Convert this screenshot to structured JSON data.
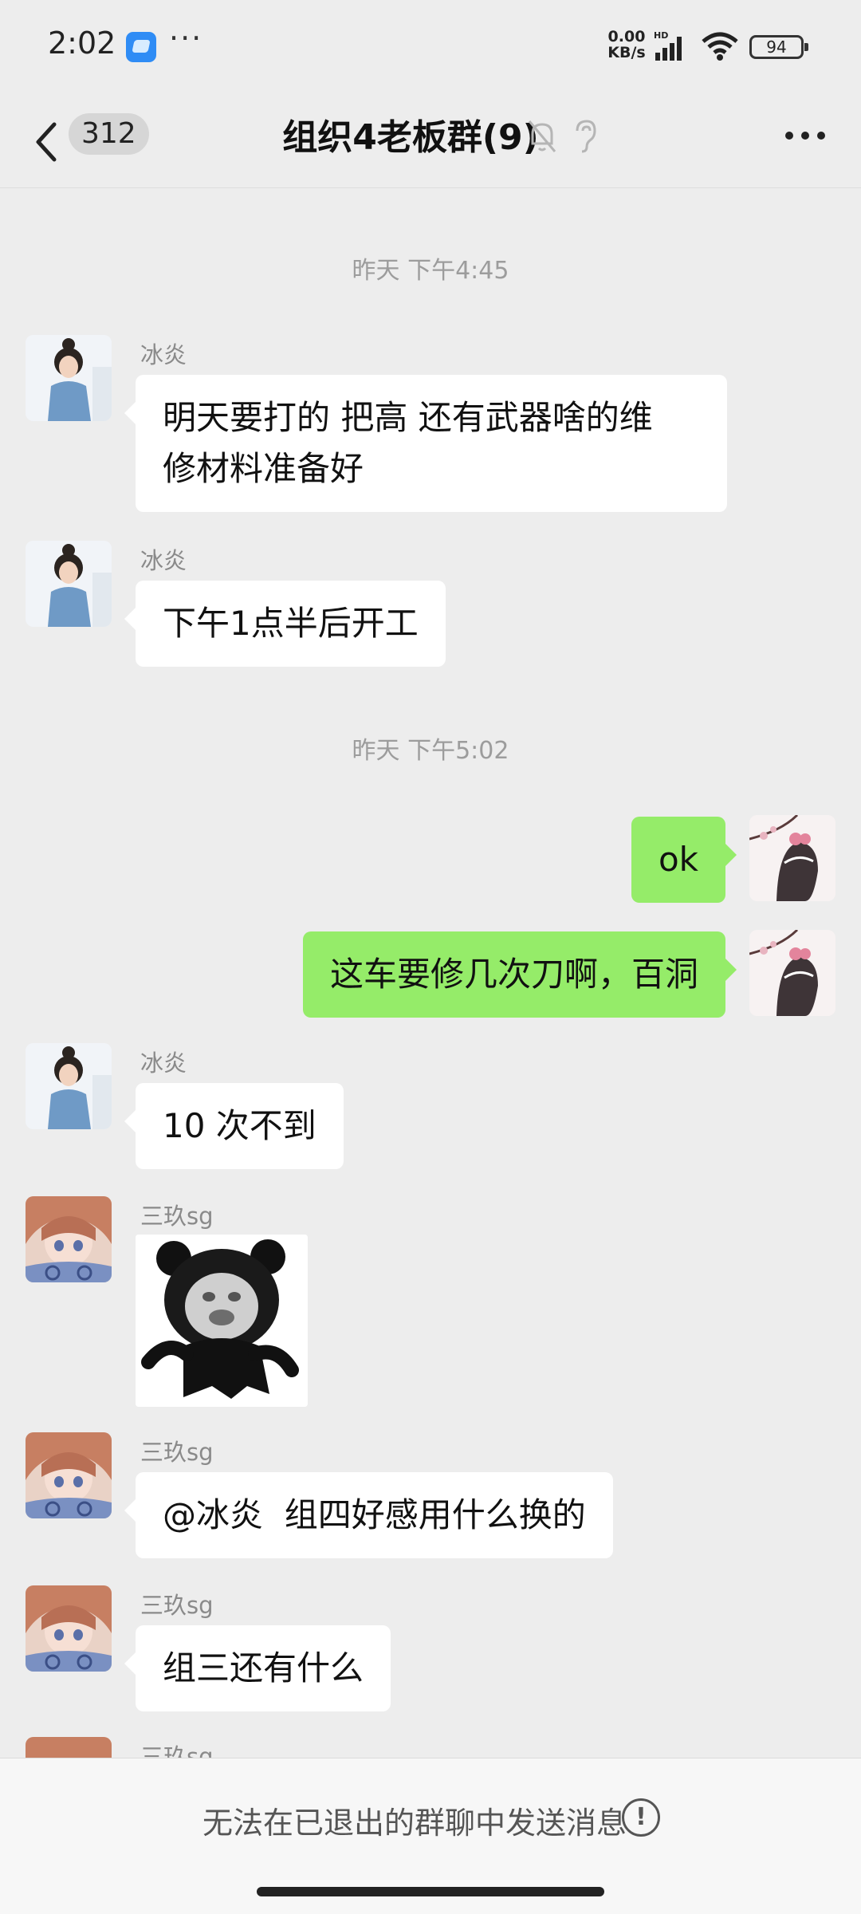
{
  "status_bar": {
    "time": "2:02",
    "more_dots": "···",
    "net_speed_value": "0.00",
    "net_speed_unit": "KB/s",
    "signal_label": "HD",
    "battery": "94",
    "icons": [
      "app-icon",
      "signal-icon",
      "wifi-icon",
      "battery-icon"
    ]
  },
  "header": {
    "unread_count": "312",
    "title": "组织4老板群(9)",
    "icons": [
      "back-icon",
      "mute-bell-icon",
      "ear-icon",
      "more-icon"
    ]
  },
  "messages": {
    "time_1": "昨天 下午4:45",
    "time_2": "昨天 下午5:02",
    "m1": {
      "sender": "冰炎",
      "text_line1": "明天要打的 把高 还有武器啥的维",
      "text_line2": "修材料准备好"
    },
    "m2": {
      "sender": "冰炎",
      "text": "下午1点半后开工"
    },
    "m3": {
      "sender": "self",
      "text": "ok"
    },
    "m4": {
      "sender": "self",
      "text": "这车要修几次刀啊，百洞"
    },
    "m5": {
      "sender": "冰炎",
      "text": "10 次不到"
    },
    "m6": {
      "sender": "三玖sg",
      "content": "panda-meme-sticker"
    },
    "m7": {
      "sender": "三玖sg",
      "text": "@冰炎  组四好感用什么换的"
    },
    "m8": {
      "sender": "三玖sg",
      "text": "组三还有什么"
    },
    "m9": {
      "sender": "三玖sg"
    }
  },
  "footer": {
    "notice": "无法在已退出的群聊中发送消息",
    "info_icon": "!"
  },
  "colors": {
    "background": "#ededed",
    "bubble_incoming": "#ffffff",
    "bubble_outgoing": "#95ec69",
    "name_text": "#8a8a8a"
  }
}
